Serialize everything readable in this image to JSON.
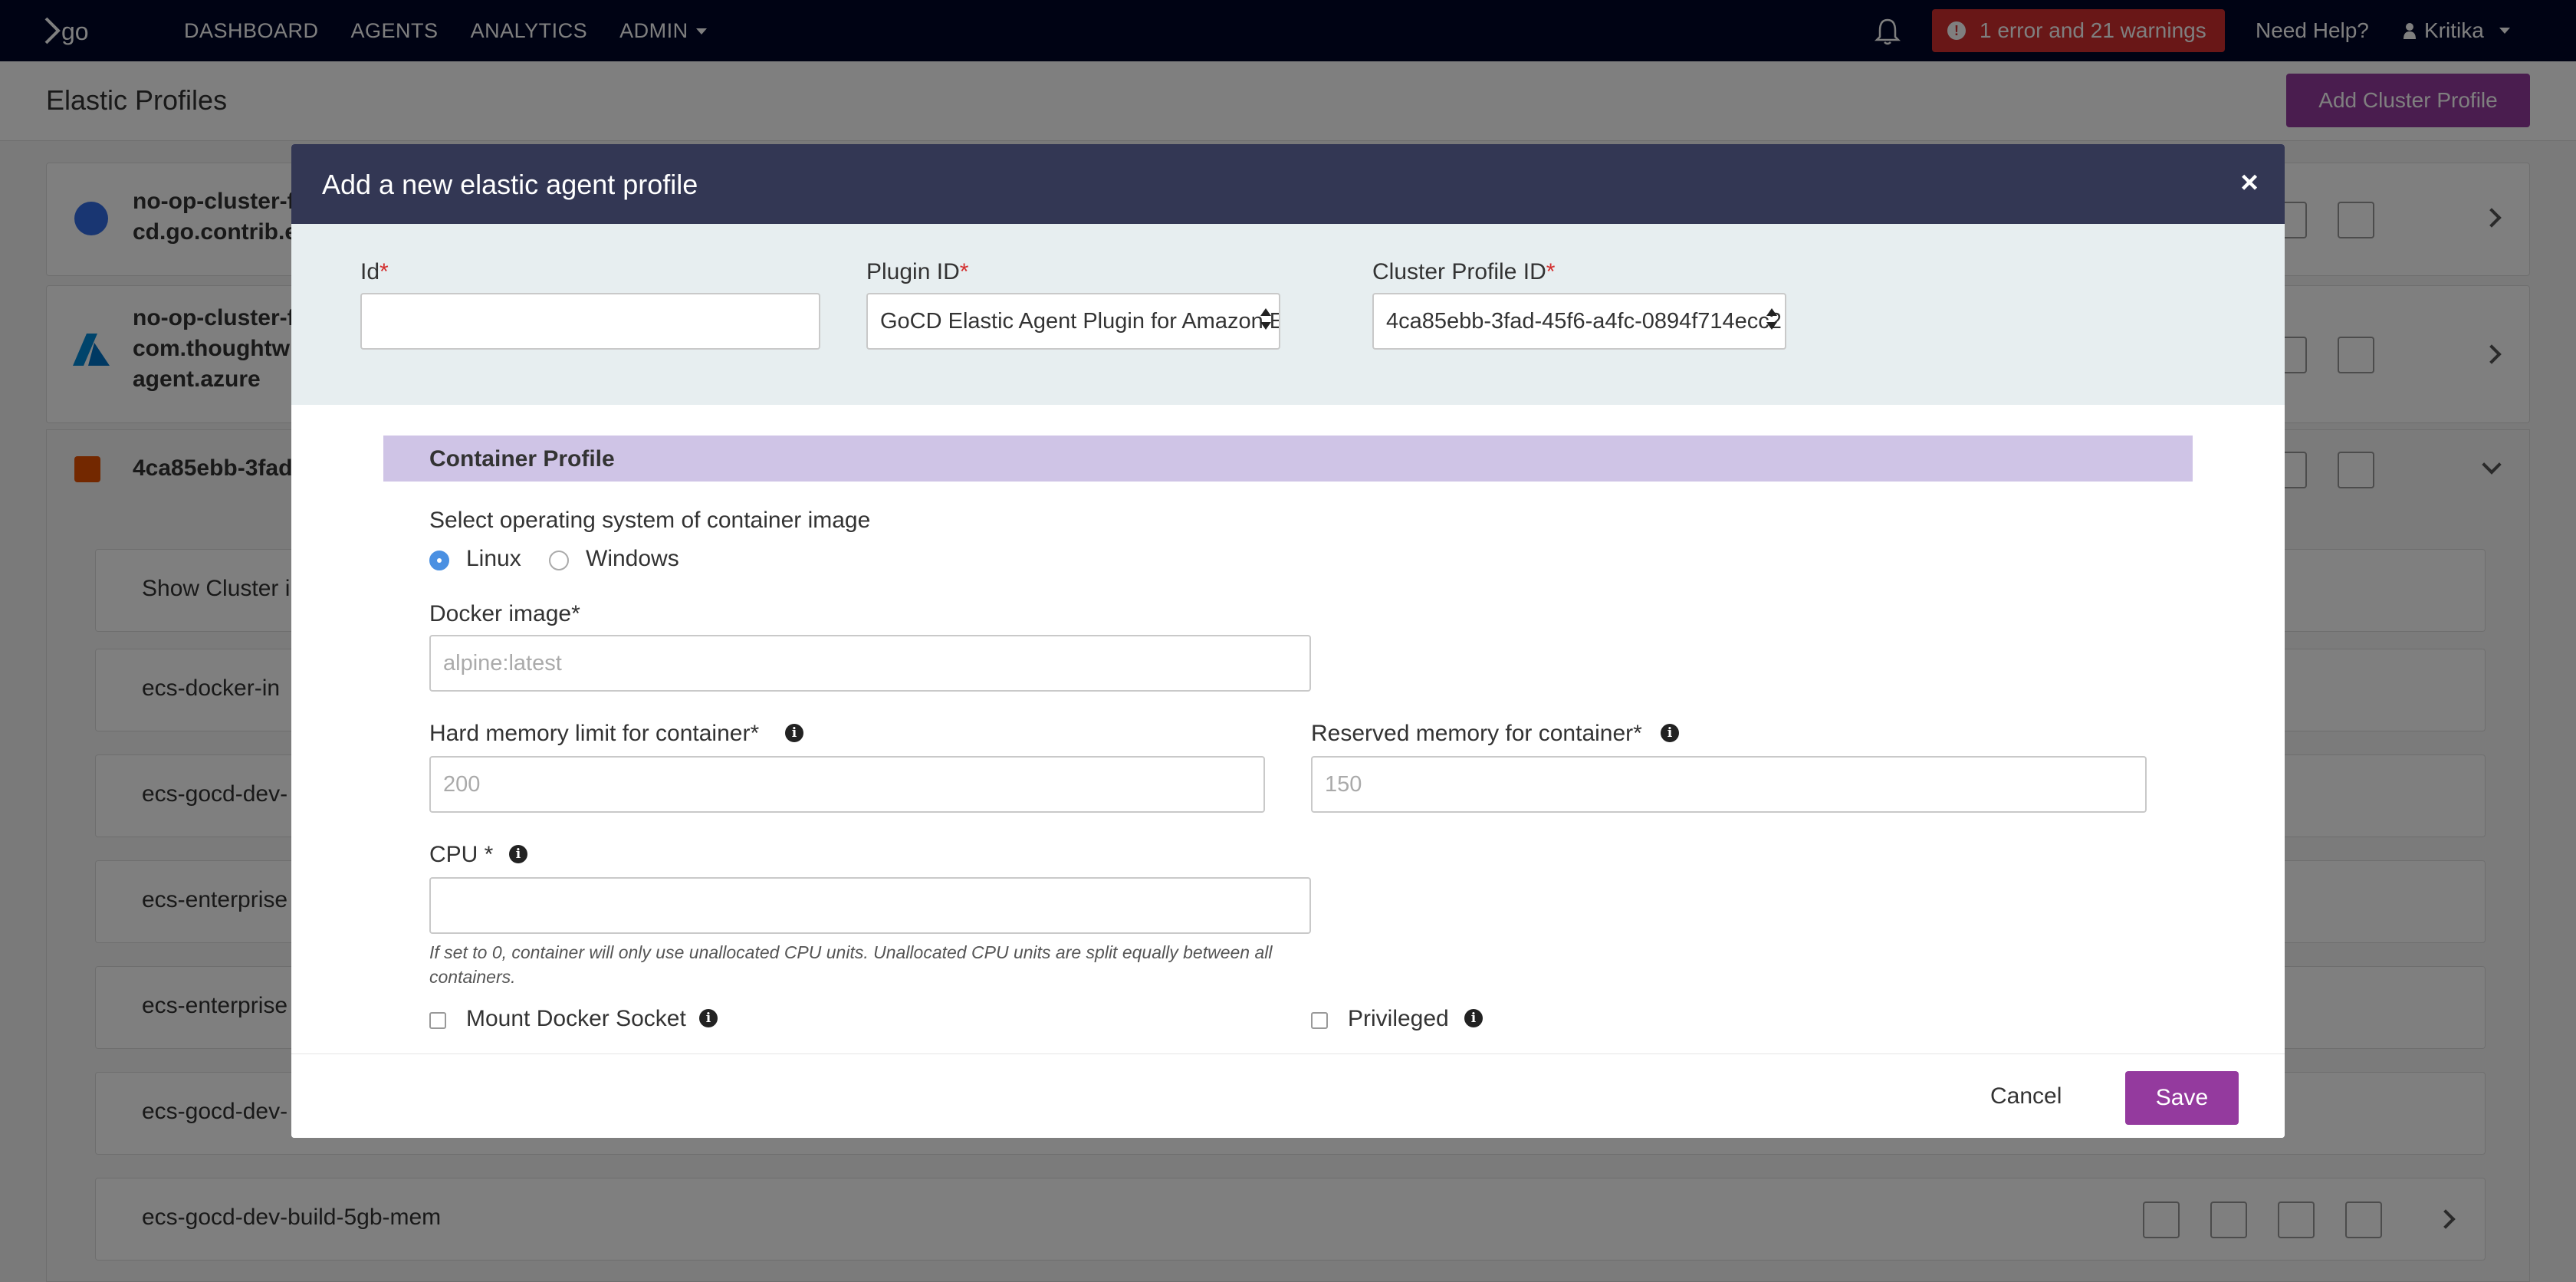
{
  "nav": {
    "logo_text": "go",
    "links": [
      "DASHBOARD",
      "AGENTS",
      "ANALYTICS",
      "ADMIN"
    ],
    "warning_badge": "1 error and 21 warnings",
    "need_help": "Need Help?",
    "user": "Kritika"
  },
  "page": {
    "title": "Elastic Profiles",
    "add_cluster_button": "Add Cluster Profile"
  },
  "background": {
    "clusters": [
      {
        "name_line1": "no-op-cluster-f",
        "name_line2": "cd.go.contrib.e"
      },
      {
        "name_line1": "no-op-cluster-f",
        "name_line2": "com.thoughtw",
        "name_line3": "agent.azure"
      },
      {
        "name_line1": "4ca85ebb-3fad"
      }
    ],
    "show_cluster_info": "Show Cluster in",
    "profiles": [
      "ecs-docker-in",
      "ecs-gocd-dev-",
      "ecs-enterprise",
      "ecs-enterprise",
      "ecs-gocd-dev-",
      "ecs-gocd-dev-build-5gb-mem"
    ]
  },
  "modal": {
    "title": "Add a new elastic agent profile",
    "close_symbol": "×",
    "id_label": "Id",
    "id_value": "",
    "plugin_label": "Plugin ID",
    "plugin_value": "GoCD Elastic Agent Plugin for Amazon ECS",
    "cluster_label": "Cluster Profile ID",
    "cluster_value": "4ca85ebb-3fad-45f6-a4fc-0894f714ecc2",
    "required_mark": "*",
    "section_title": "Container Profile",
    "os_label": "Select operating system of container image",
    "os_options": [
      "Linux",
      "Windows"
    ],
    "docker_image_label": "Docker image*",
    "docker_image_placeholder": "alpine:latest",
    "hard_mem_label": "Hard memory limit for container*",
    "hard_mem_placeholder": "200",
    "reserved_mem_label": "Reserved memory for container*",
    "reserved_mem_placeholder": "150",
    "cpu_label": "CPU *",
    "cpu_value": "",
    "cpu_help": "If set to 0, container will only use unallocated CPU units. Unallocated CPU units are split equally between all containers.",
    "mount_socket_label": "Mount Docker Socket",
    "privileged_label": "Privileged",
    "info_symbol": "i",
    "cancel": "Cancel",
    "save": "Save"
  }
}
